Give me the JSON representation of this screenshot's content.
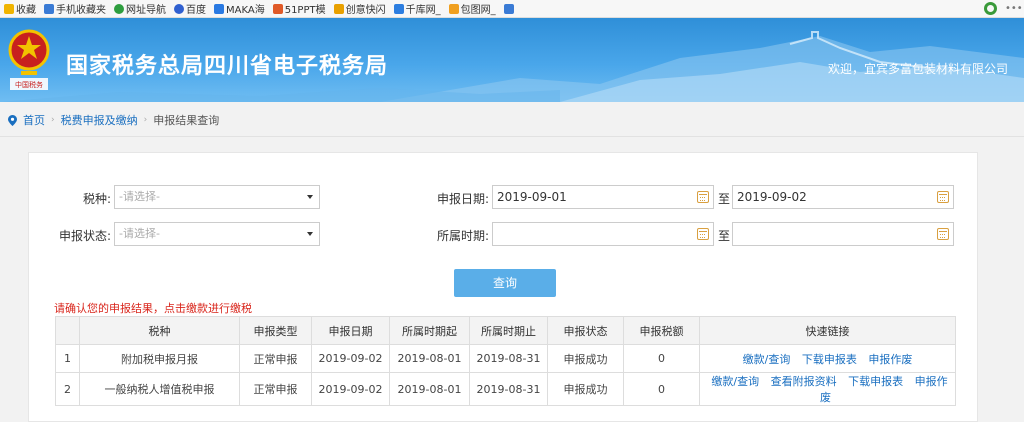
{
  "bookmarks": {
    "items": [
      {
        "label": "收藏",
        "icon": "star-icon",
        "color": "#f0b400"
      },
      {
        "label": "手机收藏夹",
        "icon": "phone-icon",
        "color": "#3a7bd5"
      },
      {
        "label": "网址导航",
        "icon": "compass-icon",
        "color": "#2e9e3f"
      },
      {
        "label": "百度",
        "icon": "paw-icon",
        "color": "#3060d0"
      },
      {
        "label": "MAKA海",
        "icon": "maka-icon",
        "color": "#2a7ae2"
      },
      {
        "label": "51PPT模",
        "icon": "ppt-icon",
        "color": "#e05a28"
      },
      {
        "label": "创意快闪",
        "icon": "spark-icon",
        "color": "#e8a000"
      },
      {
        "label": "千库网_",
        "icon": "k-icon",
        "color": "#2d7ee0"
      },
      {
        "label": "包图网_",
        "icon": "bag-icon",
        "color": "#f0a020"
      },
      {
        "label": "",
        "icon": "app-icon",
        "color": "#3a7bd5"
      }
    ]
  },
  "header": {
    "site_title": "国家税务总局四川省电子税务局",
    "welcome": "欢迎，宜宾多富包装材料有限公司",
    "emblem_seal": "中国税务"
  },
  "breadcrumb": {
    "home": "首页",
    "section": "税费申报及缴纳",
    "current": "申报结果查询"
  },
  "form": {
    "tax_type_label": "税种:",
    "tax_type_placeholder": "-请选择-",
    "status_label": "申报状态:",
    "status_placeholder": "-请选择-",
    "declare_date_label": "申报日期:",
    "declare_date_from": "2019-09-01",
    "declare_date_to": "2019-09-02",
    "to_label": "至",
    "period_label": "所属时期:",
    "period_from": "",
    "period_to": "",
    "query_button": "查询"
  },
  "notice": "请确认您的申报结果，点击缴款进行缴税",
  "table": {
    "headers": [
      "",
      "税种",
      "申报类型",
      "申报日期",
      "所属时期起",
      "所属时期止",
      "申报状态",
      "申报税额",
      "快速链接"
    ],
    "rows": [
      {
        "no": "1",
        "tax": "附加税申报月报",
        "type": "正常申报",
        "date": "2019-09-02",
        "from": "2019-08-01",
        "to": "2019-08-31",
        "status": "申报成功",
        "amount": "0",
        "links": [
          "缴款/查询",
          "下载申报表",
          "申报作废"
        ]
      },
      {
        "no": "2",
        "tax": "一般纳税人增值税申报",
        "type": "正常申报",
        "date": "2019-09-02",
        "from": "2019-08-01",
        "to": "2019-08-31",
        "status": "申报成功",
        "amount": "0",
        "links": [
          "缴款/查询",
          "查看附报资料",
          "下载申报表",
          "申报作废"
        ]
      }
    ]
  }
}
